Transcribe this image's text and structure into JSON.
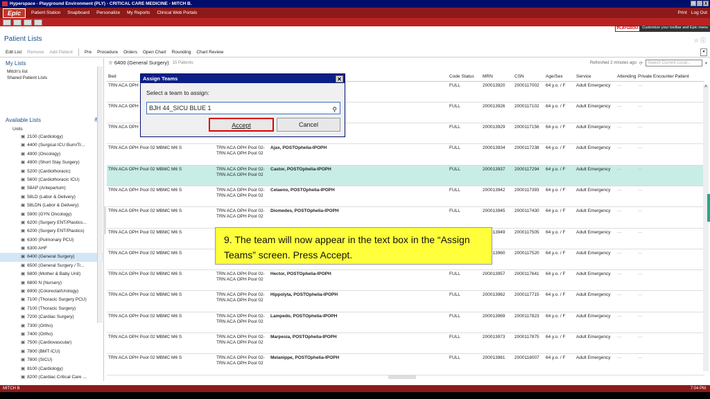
{
  "window": {
    "title": "Hyperspace - Playground Environment (PLY) - CRITICAL CARE MEDICINE - MITCH B.",
    "buttons": [
      "_",
      "□",
      "X"
    ]
  },
  "epic": {
    "logo": "Epic",
    "menu": [
      "Patient Station",
      "Snapboard",
      "Personalize",
      "My Reports",
      "Clinical Web Portals"
    ],
    "print": "Print",
    "logout": "Log Out"
  },
  "playground": {
    "badge": "PLAYGROU",
    "note": "Customize your toolbar and Epic menu"
  },
  "page": {
    "title": "Patient Lists",
    "title_icons": "☆ ⓘ"
  },
  "toolbar": {
    "items": [
      "Edit List",
      "Remove",
      "Add Patient",
      "Pre",
      "Procedure",
      "Orders",
      "Open Chart",
      "Rounding",
      "Chart Review"
    ]
  },
  "left": {
    "my_lists": "My Lists",
    "mitch_list": "Mitch's list",
    "shared": "Shared Patient Lists",
    "available": "Available Lists",
    "units": "Units",
    "unit_items": [
      "2100 (Cardiology)",
      "4400 (Surgical ICU Burn/Tr...",
      "4900 (Oncology)",
      "4900 (Short Stay Surgery)",
      "5200 (Cardiothoracic)",
      "5600 (Cardiothoracic ICU)",
      "58AP (Antepartum)",
      "58LD (Labor & Delivery)",
      "58LDN (Labor & Delivery)",
      "5900 (GYN Oncology)",
      "6200 (Surgery ENT/Plastics...",
      "6200 (Surgery ENT/Plastics)",
      "6300 (Pulmonary PCU)",
      "6300 AHF",
      "6400 (General Surgery)",
      "6500 (General Surgery / Tr...",
      "6800 (Mother & Baby Unit)",
      "6800 N (Nursery)",
      "6900 (Colorectal/Urology)",
      "7100 (Thoracic Surgery PCU)",
      "7100 (Thoracic Surgery)",
      "7200 (Cardiac Surgery)",
      "7300 (Ortho)",
      "7400 (Ortho)",
      "7500 (Cardiovascular)",
      "7800 (BMT ICU)",
      "7800 (SICU)",
      "8100 (Cardiology)",
      "8200 (Cardiac Critical Care ..."
    ]
  },
  "list": {
    "name": "6400 (General Surgery)",
    "count": "15 Patients",
    "refreshed": "Refreshed 2 minutes ago",
    "search_placeholder": "Search Current Locat...",
    "columns": [
      "Bed",
      "",
      "",
      "Code Status",
      "MRN",
      "CSN",
      "Age/Sex",
      "Service",
      "Attending",
      "Private Encounter Patient"
    ],
    "rows": [
      {
        "bed": "TRN ACA OPH",
        "unit": "",
        "name": "",
        "code": "FULL",
        "mrn": "200013920",
        "csn": "2000117002",
        "age": "64 y.o. / F",
        "service": "Adult Emergency"
      },
      {
        "bed": "TRN ACA OPH",
        "unit": "",
        "name": "",
        "code": "FULL",
        "mrn": "200013926",
        "csn": "2000117102",
        "age": "64 y.o. / F",
        "service": "Adult Emergency"
      },
      {
        "bed": "TRN ACA OPH",
        "unit": "Pool 02",
        "name": "",
        "code": "FULL",
        "mrn": "200013929",
        "csn": "2000117156",
        "age": "64 y.o. / F",
        "service": "Adult Emergency"
      },
      {
        "bed": "TRN ACA OPH Pool 02  MBMC M6 S",
        "unit": "TRN ACA OPH Pool 02-TRN ACA OPH Pool 02",
        "name": "Ajax, POSTOphelia-IPOPH",
        "code": "FULL",
        "mrn": "200013934",
        "csn": "2000117238",
        "age": "64 y.o. / F",
        "service": "Adult Emergency"
      },
      {
        "bed": "TRN ACA OPH Pool 02  MBMC M6 S",
        "unit": "TRN ACA OPH Pool 02-TRN ACA OPH Pool 02",
        "name": "Castor, POSTOphelia-IPOPH",
        "code": "FULL",
        "mrn": "200013937",
        "csn": "2000117294",
        "age": "64 y.o. / F",
        "service": "Adult Emergency",
        "hl": true
      },
      {
        "bed": "TRN ACA OPH Pool 02  MBMC M6 S",
        "unit": "TRN ACA OPH Pool 02-TRN ACA OPH Pool 02",
        "name": "Celaeno, POSTOphelia-IPOPH",
        "code": "FULL",
        "mrn": "200013942",
        "csn": "2000117393",
        "age": "64 y.o. / F",
        "service": "Adult Emergency"
      },
      {
        "bed": "TRN ACA OPH Pool 02  MBMC M6 S",
        "unit": "TRN ACA OPH Pool 02-TRN ACA OPH Pool 02",
        "name": "Diomedes, POSTOphelia-IPOPH",
        "code": "FULL",
        "mrn": "200013945",
        "csn": "2000117430",
        "age": "64 y.o. / F",
        "service": "Adult Emergency"
      },
      {
        "bed": "TRN ACA OPH Pool 02  MBMC M6 S",
        "unit": "",
        "name": "",
        "code": "",
        "mrn": "200013949",
        "csn": "2000117505",
        "age": "64 y.o. / F",
        "service": "Adult Emergency"
      },
      {
        "bed": "TRN ACA OPH Pool 02  MBMC M6 S",
        "unit": "",
        "name": "",
        "code": "",
        "mrn": "200013960",
        "csn": "2000117520",
        "age": "64 y.o. / F",
        "service": "Adult Emergency"
      },
      {
        "bed": "TRN ACA OPH Pool 02  MBMC M6 S",
        "unit": "TRN ACA OPH Pool 02-TRN ACA OPH Pool 02",
        "name": "Hector, POSTOphelia-IPOPH",
        "code": "FULL",
        "mrn": "200013957",
        "csn": "2000117641",
        "age": "64 y.o. / F",
        "service": "Adult Emergency"
      },
      {
        "bed": "TRN ACA OPH Pool 02  MBMC M6 S",
        "unit": "TRN ACA OPH Pool 02-TRN ACA OPH Pool 02",
        "name": "Hippolyta, POSTOphelia-IPOPH",
        "code": "FULL",
        "mrn": "200013962",
        "csn": "2000117715",
        "age": "64 y.o. / F",
        "service": "Adult Emergency"
      },
      {
        "bed": "TRN ACA OPH Pool 02  MBMC M6 S",
        "unit": "TRN ACA OPH Pool 02-TRN ACA OPH Pool 02",
        "name": "Lampedo, POSTOphelia-IPOPH",
        "code": "FULL",
        "mrn": "200013969",
        "csn": "2000117823",
        "age": "64 y.o. / F",
        "service": "Adult Emergency"
      },
      {
        "bed": "TRN ACA OPH Pool 02  MBMC M6 S",
        "unit": "TRN ACA OPH Pool 02-TRN ACA OPH Pool 02",
        "name": "Marpesia, POSTOphelia-IPOPH",
        "code": "FULL",
        "mrn": "200013973",
        "csn": "2000117875",
        "age": "64 y.o. / F",
        "service": "Adult Emergency"
      },
      {
        "bed": "TRN ACA OPH Pool 02  MBMC M6 S",
        "unit": "TRN ACA OPH Pool 02-TRN ACA OPH Pool 02",
        "name": "Melanippe, POSTOphelia-IPOPH",
        "code": "FULL",
        "mrn": "200013981",
        "csn": "2000118007",
        "age": "64 y.o. / F",
        "service": "Adult Emergency"
      }
    ]
  },
  "dialog": {
    "title": "Assign Teams",
    "prompt": "Select a team to assign:",
    "value": "BJH 44_SICU BLUE 1",
    "accept": "Accept",
    "cancel": "Cancel"
  },
  "callout": {
    "text": "9. The team will now appear in the text box in the “Assign Teams” screen.   Press Accept."
  },
  "status": {
    "user": "MITCH B",
    "time": "7:04 PM"
  }
}
